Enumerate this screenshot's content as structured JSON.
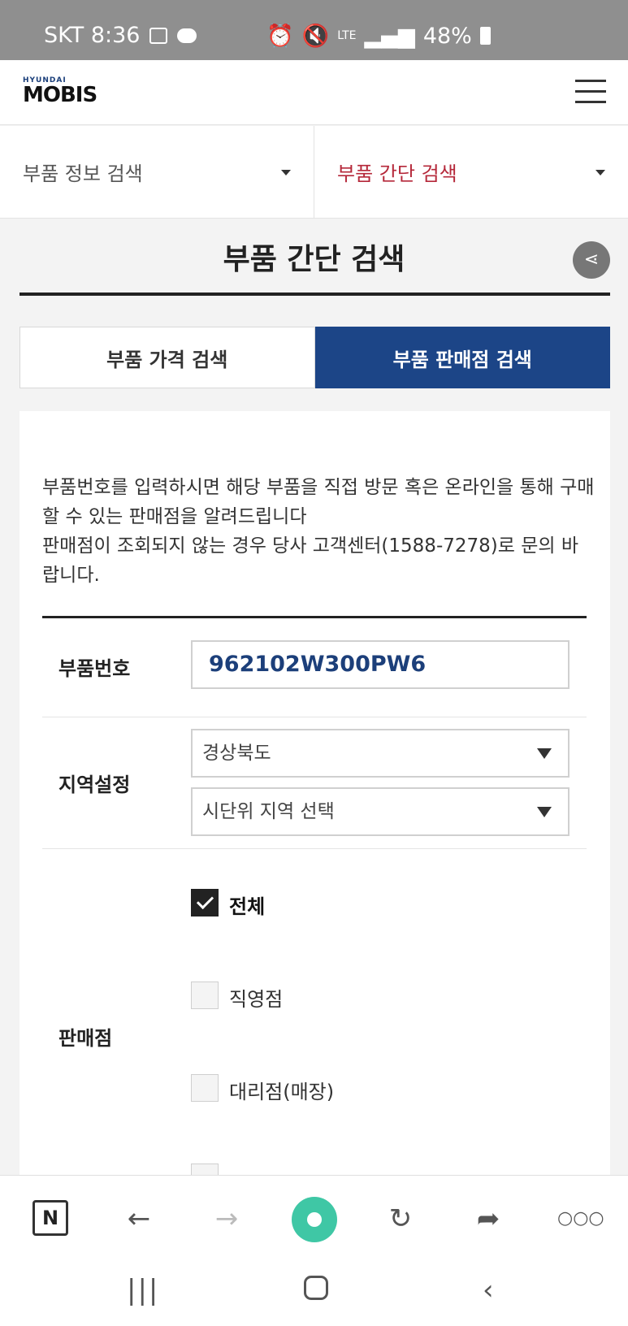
{
  "status_bar": {
    "carrier_time": "SKT 8:36",
    "network": "LTE",
    "battery": "48%"
  },
  "brand": {
    "top": "HYUNDAI",
    "main": "MOBIS"
  },
  "nav": {
    "left": "부품 정보 검색",
    "right": "부품 간단 검색"
  },
  "page": {
    "title": "부품 간단 검색"
  },
  "tabs": {
    "price": "부품 가격 검색",
    "dealer": "부품 판매점 검색"
  },
  "description": {
    "line1": "부품번호를 입력하시면 해당 부품을 직접 방문 혹은 온라인을 통해 구매 할 수 있는 판매점을 알려드립니다",
    "line2": "판매점이 조회되지 않는 경우 당사 고객센터(1588-7278)로 문의 바랍니다."
  },
  "form": {
    "part_label": "부품번호",
    "part_value": "962102W300PW6",
    "region_label": "지역설정",
    "province": "경상북도",
    "city": "시단위 지역 선택",
    "dealer_label": "판매점",
    "options": [
      {
        "label": "전체",
        "checked": true
      },
      {
        "label": "직영점",
        "checked": false
      },
      {
        "label": "대리점(매장)",
        "checked": false
      }
    ]
  },
  "colors": {
    "accent": "#1c4587",
    "active_nav": "#b5283a"
  },
  "icons": [
    "share-icon",
    "hamburger-icon",
    "n-icon",
    "back-arrow-icon",
    "forward-arrow-icon",
    "refresh-icon",
    "share-arrow-icon",
    "more-icon"
  ]
}
